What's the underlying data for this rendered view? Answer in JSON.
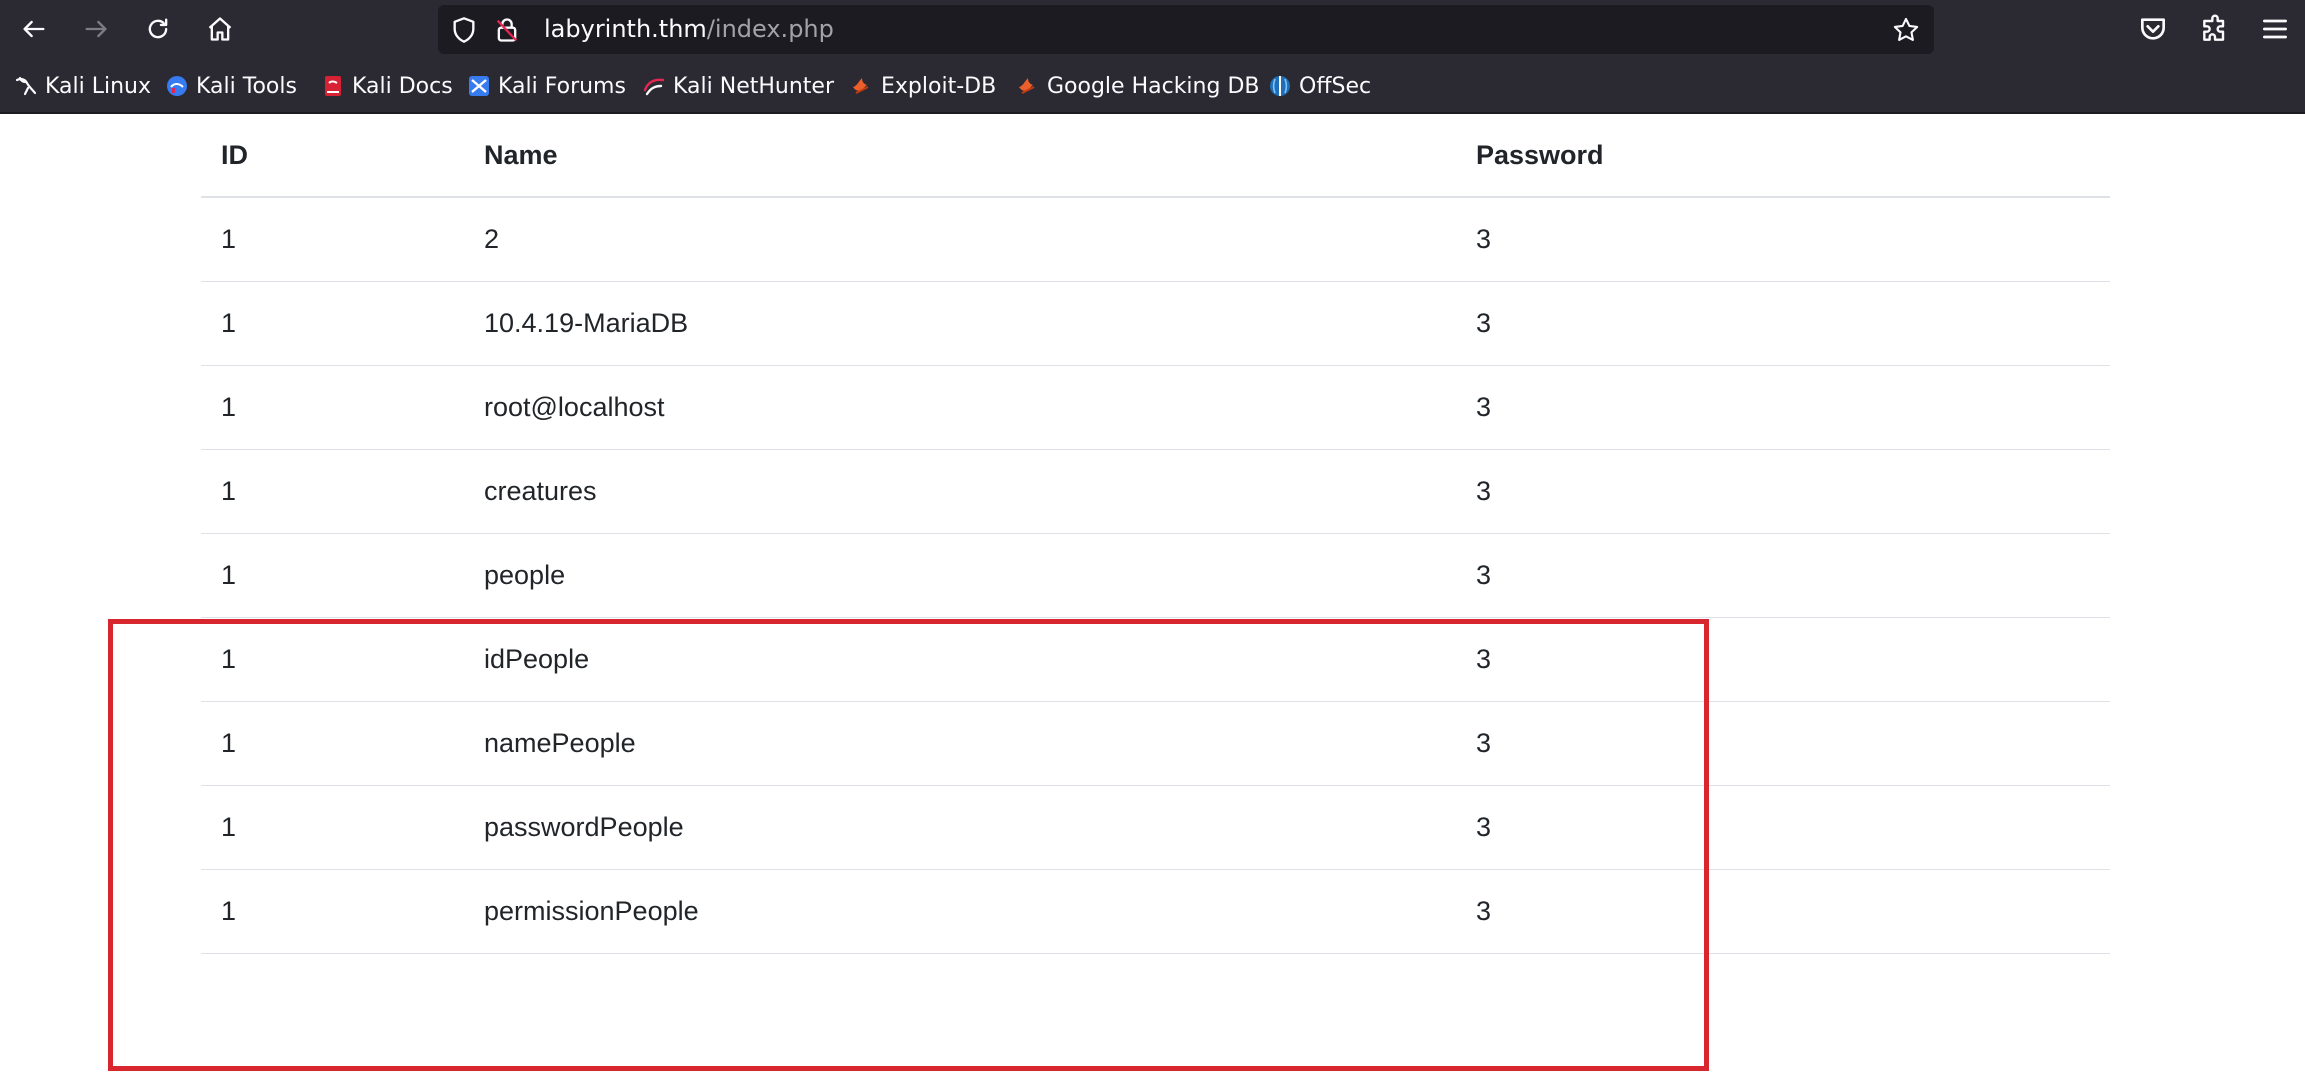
{
  "browser": {
    "url_host": "labyrinth.thm",
    "url_path": "/index.php",
    "icons": {
      "back": "arrow-left-icon",
      "forward": "arrow-right-icon",
      "reload": "reload-icon",
      "home": "home-icon",
      "tracking": "shield-icon",
      "insecure": "insecure-lock-icon",
      "bookmark": "star-icon",
      "pocket": "pocket-icon",
      "extensions": "puzzle-icon",
      "menu": "hamburger-menu-icon"
    }
  },
  "bookmarks": [
    {
      "label": "Kali Linux",
      "icon": "kali-dragon-icon"
    },
    {
      "label": "Kali Tools",
      "icon": "kali-tools-icon"
    },
    {
      "label": "Kali Docs",
      "icon": "kali-docs-icon"
    },
    {
      "label": "Kali Forums",
      "icon": "kali-forums-icon"
    },
    {
      "label": "Kali NetHunter",
      "icon": "kali-nethunter-icon"
    },
    {
      "label": "Exploit-DB",
      "icon": "exploit-db-icon"
    },
    {
      "label": "Google Hacking DB",
      "icon": "ghdb-icon"
    },
    {
      "label": "OffSec",
      "icon": "offsec-icon"
    }
  ],
  "table": {
    "headers": {
      "id": "ID",
      "name": "Name",
      "password": "Password"
    },
    "rows": [
      {
        "id": "1",
        "name": "2",
        "password": "3"
      },
      {
        "id": "1",
        "name": "10.4.19-MariaDB",
        "password": "3"
      },
      {
        "id": "1",
        "name": "root@localhost",
        "password": "3"
      },
      {
        "id": "1",
        "name": "creatures",
        "password": "3"
      },
      {
        "id": "1",
        "name": "people",
        "password": "3"
      },
      {
        "id": "1",
        "name": "idPeople",
        "password": "3"
      },
      {
        "id": "1",
        "name": "namePeople",
        "password": "3"
      },
      {
        "id": "1",
        "name": "passwordPeople",
        "password": "3"
      },
      {
        "id": "1",
        "name": "permissionPeople",
        "password": "3"
      }
    ]
  },
  "annotation": {
    "color": "#d7262e"
  },
  "colors": {
    "chrome": "#2b2a33",
    "urlbar": "#1c1b22",
    "text": "#212529",
    "border": "#dee2e6"
  }
}
